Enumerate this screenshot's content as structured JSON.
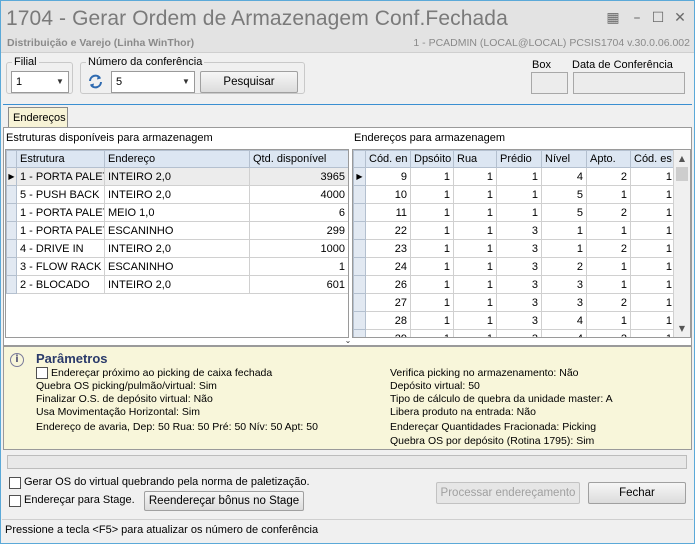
{
  "window": {
    "title": "1704 - Gerar Ordem de Armazenagem Conf.Fechada",
    "subtitle": "Distribuição e Varejo (Linha WinThor)",
    "info": "1 - PCADMIN (LOCAL@LOCAL)   PCSIS1704  v.30.0.06.002"
  },
  "filters": {
    "filial_label": "Filial",
    "filial_value": "1",
    "conferencia_label": "Número da conferência",
    "conferencia_value": "5",
    "search_button": "Pesquisar",
    "box_label": "Box",
    "data_conferencia_label": "Data de Conferência"
  },
  "tabs": [
    {
      "label": "Endereços"
    }
  ],
  "left_grid": {
    "title": "Estruturas disponíveis para armazenagem",
    "columns": [
      "Estrutura",
      "Endereço",
      "Qtd. disponível"
    ],
    "rows": [
      [
        "1 - PORTA PALET",
        "INTEIRO 2,0",
        "3965"
      ],
      [
        "5 - PUSH BACK",
        "INTEIRO 2,0",
        "4000"
      ],
      [
        "1 - PORTA PALET",
        "MEIO 1,0",
        "6"
      ],
      [
        "1 - PORTA PALET",
        "ESCANINHO",
        "299"
      ],
      [
        "4 - DRIVE IN",
        "INTEIRO 2,0",
        "1000"
      ],
      [
        "3 - FLOW RACK",
        "ESCANINHO",
        "1"
      ],
      [
        "2 - BLOCADO",
        "INTEIRO 2,0",
        "601"
      ]
    ]
  },
  "right_grid": {
    "title": "Endereços para armazenagem",
    "columns": [
      "Cód. en",
      "Dpsóito",
      "Rua",
      "Prédio",
      "Nível",
      "Apto.",
      "Cód. es"
    ],
    "rows": [
      [
        "9",
        "1",
        "1",
        "1",
        "4",
        "2",
        "1"
      ],
      [
        "10",
        "1",
        "1",
        "1",
        "5",
        "1",
        "1"
      ],
      [
        "11",
        "1",
        "1",
        "1",
        "5",
        "2",
        "1"
      ],
      [
        "22",
        "1",
        "1",
        "3",
        "1",
        "1",
        "1"
      ],
      [
        "23",
        "1",
        "1",
        "3",
        "1",
        "2",
        "1"
      ],
      [
        "24",
        "1",
        "1",
        "3",
        "2",
        "1",
        "1"
      ],
      [
        "26",
        "1",
        "1",
        "3",
        "3",
        "1",
        "1"
      ],
      [
        "27",
        "1",
        "1",
        "3",
        "3",
        "2",
        "1"
      ],
      [
        "28",
        "1",
        "1",
        "3",
        "4",
        "1",
        "1"
      ],
      [
        "29",
        "1",
        "1",
        "3",
        "4",
        "2",
        "1"
      ]
    ]
  },
  "params": {
    "title": "Parâmetros",
    "left": [
      "Endereçar próximo ao picking de caixa fechada",
      "Quebra OS picking/pulmão/virtual: Sim",
      "Finalizar O.S. de depósito virtual: Não",
      "Usa Movimentação Horizontal: Sim",
      "Endereço de avaria, Dep: 50 Rua: 50 Pré: 50 Nív: 50 Apt: 50"
    ],
    "right": [
      "Verifica picking no armazenamento: Não",
      "Depósito virtual: 50",
      "Tipo de cálculo de quebra da unidade master: A",
      "Libera produto na entrada: Não",
      "Endereçar Quantidades Fracionada: Picking",
      "Quebra OS por depósito (Rotina 1795): Sim"
    ]
  },
  "options": {
    "gerar_os_label": "Gerar OS do virtual quebrando pela norma de paletização.",
    "enderecar_stage_label": "Endereçar para Stage.",
    "reenderecar_button": "Reendereçar bônus no Stage",
    "processar_button": "Processar endereçamento",
    "fechar_button": "Fechar"
  },
  "status": "Pressione a tecla <F5> para atualizar os número de conferência"
}
